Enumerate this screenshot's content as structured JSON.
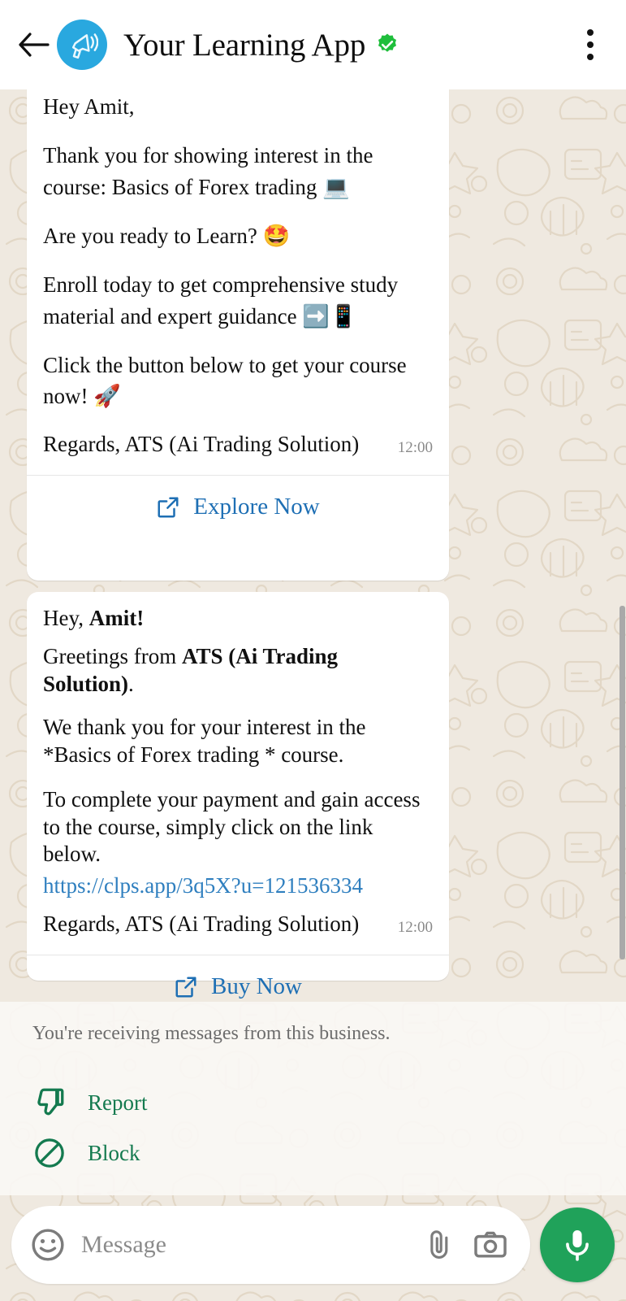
{
  "header": {
    "back_icon": "back-arrow-icon",
    "avatar_icon": "megaphone-icon",
    "title": "Your Learning App",
    "verified_icon": "verified-badge-icon",
    "menu_icon": "overflow-menu-icon",
    "avatar_color": "#29A8DF",
    "verified_color": "#1FBE3C"
  },
  "messages": [
    {
      "id": "message-1",
      "lines": [
        "Hey Amit,",
        "Thank you for showing interest in the course: Basics of Forex trading 💻",
        "Are you ready to Learn? 🤩",
        "Enroll today to get comprehensive study material and expert guidance ➡️📱",
        "Click the button below to get your course now! 🚀"
      ],
      "signature": "Regards, ATS (Ai Trading Solution)",
      "timestamp": "12:00",
      "cta_label": "Explore Now",
      "cta_icon": "external-link-icon"
    },
    {
      "id": "message-2",
      "greeting_prefix": "Hey, ",
      "greeting_name": "Amit!",
      "greeting_line_prefix": "Greetings from ",
      "greeting_line_bold": "ATS (Ai Trading Solution)",
      "greeting_line_suffix": ".",
      "thanks_line": "We thank you for your interest in the *Basics of Forex trading * course.",
      "payment_line": "To complete your payment and gain access to the course, simply click on the link below.",
      "link": "https://clps.app/3q5X?u=121536334",
      "signature": "Regards, ATS (Ai Trading Solution)",
      "timestamp": "12:00",
      "cta_label": "Buy Now",
      "cta_icon": "external-link-icon"
    }
  ],
  "business_panel": {
    "note": "You're receiving messages from this business.",
    "actions": [
      {
        "label": "Report",
        "icon": "thumbs-down-icon"
      },
      {
        "label": "Block",
        "icon": "block-circle-icon"
      }
    ],
    "action_color": "#147A4F"
  },
  "input_bar": {
    "emoji_icon": "emoji-smiley-icon",
    "placeholder": "Message",
    "attach_icon": "paperclip-icon",
    "camera_icon": "camera-icon",
    "mic_icon": "microphone-icon",
    "mic_color": "#20A25A"
  },
  "link_color": "#2F7FBF",
  "cta_color": "#1E6FB4"
}
